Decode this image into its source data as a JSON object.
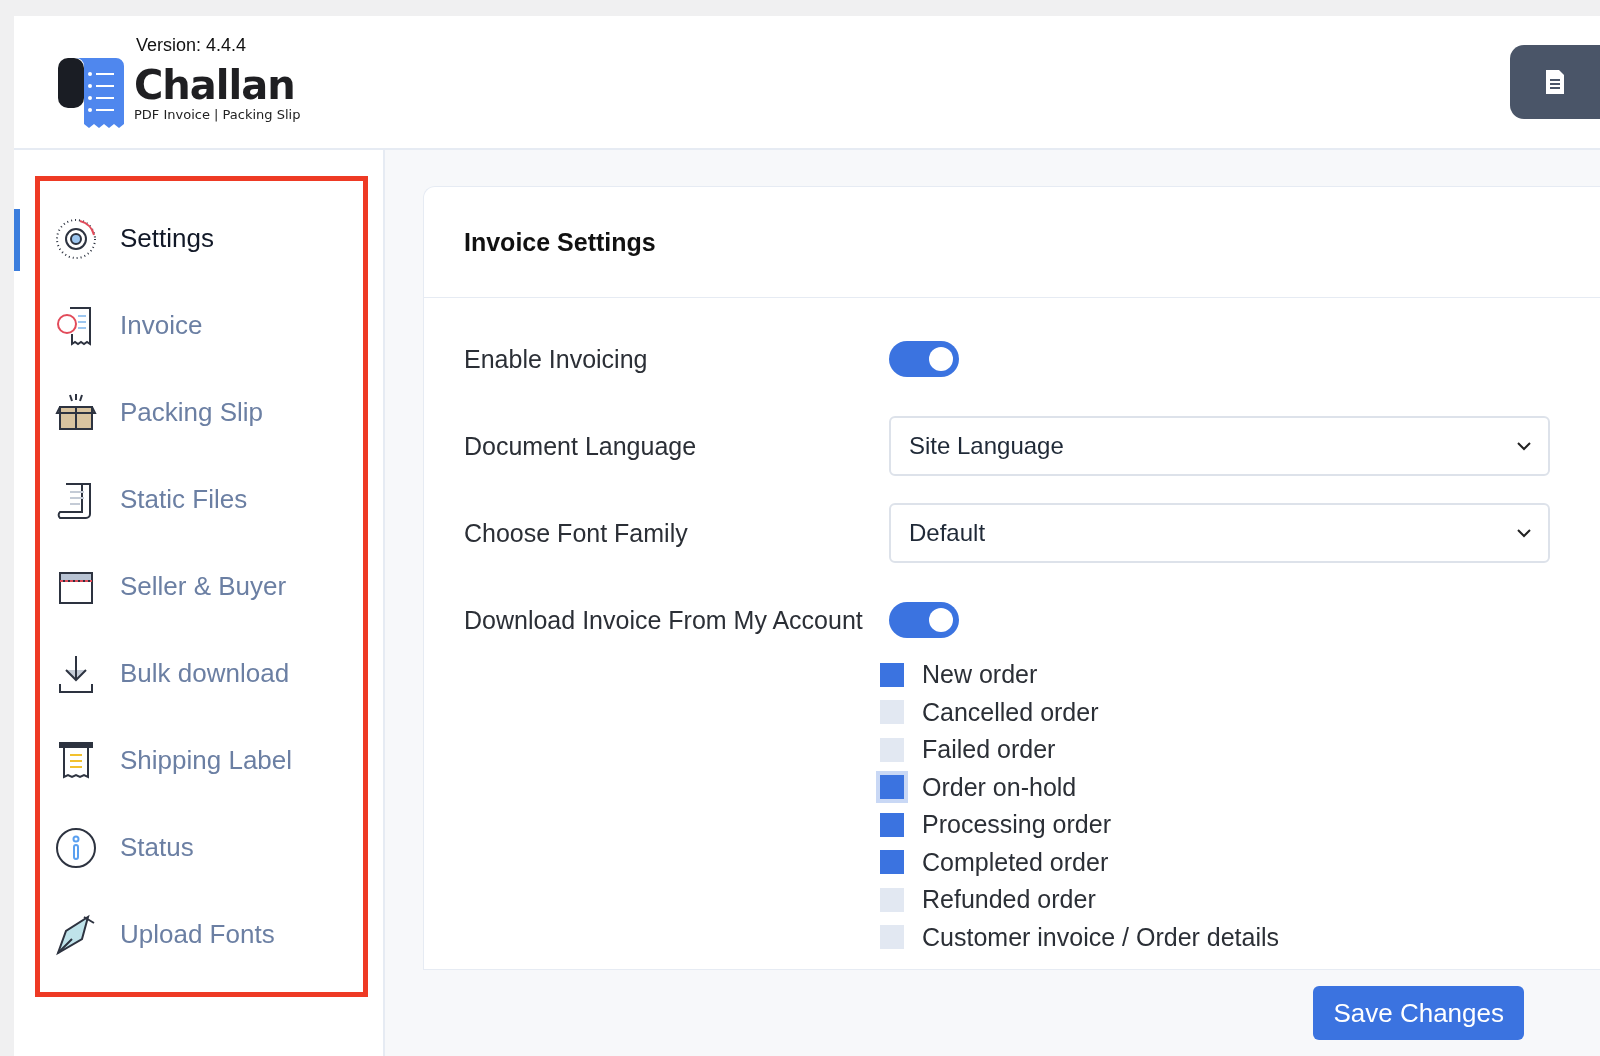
{
  "header": {
    "version": "Version: 4.4.4",
    "logo_title": "Challan",
    "logo_subtitle": "PDF Invoice | Packing Slip"
  },
  "sidebar": {
    "items": [
      {
        "label": "Settings",
        "selected": true
      },
      {
        "label": "Invoice",
        "selected": false
      },
      {
        "label": "Packing Slip",
        "selected": false
      },
      {
        "label": "Static Files",
        "selected": false
      },
      {
        "label": "Seller & Buyer",
        "selected": false
      },
      {
        "label": "Bulk download",
        "selected": false
      },
      {
        "label": "Shipping Label",
        "selected": false
      },
      {
        "label": "Status",
        "selected": false
      },
      {
        "label": "Upload Fonts",
        "selected": false
      }
    ]
  },
  "panel": {
    "title": "Invoice Settings",
    "settings": [
      {
        "kind": "toggle",
        "label": "Enable Invoicing",
        "on": true
      },
      {
        "kind": "select",
        "label": "Document Language",
        "value": "Site Language"
      },
      {
        "kind": "select",
        "label": "Choose Font Family",
        "value": "Default"
      },
      {
        "kind": "toggle",
        "label": "Download Invoice From My Account",
        "on": true
      }
    ],
    "statuses": [
      {
        "label": "New order",
        "checked": true,
        "focused": false
      },
      {
        "label": "Cancelled order",
        "checked": false,
        "focused": false
      },
      {
        "label": "Failed order",
        "checked": false,
        "focused": false
      },
      {
        "label": "Order on-hold",
        "checked": true,
        "focused": true
      },
      {
        "label": "Processing order",
        "checked": true,
        "focused": false
      },
      {
        "label": "Completed order",
        "checked": true,
        "focused": false
      },
      {
        "label": "Refunded order",
        "checked": false,
        "focused": false
      },
      {
        "label": "Customer invoice / Order details",
        "checked": false,
        "focused": false
      }
    ]
  },
  "save_button": "Save Changes"
}
